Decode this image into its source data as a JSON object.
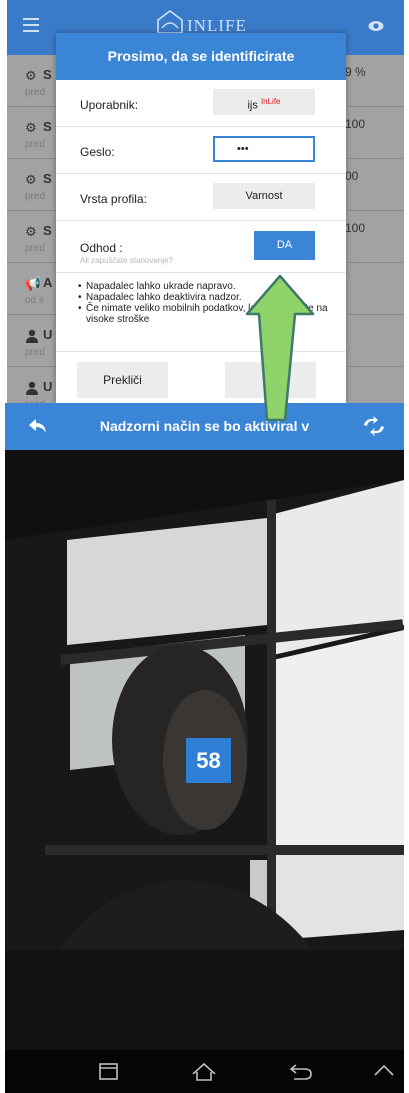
{
  "top": {
    "app_title": "INLIFE",
    "list": [
      {
        "icon": "gear-icon",
        "title": "S",
        "sub": "pred",
        "value": "9 %"
      },
      {
        "icon": "gear-icon",
        "title": "S",
        "sub": "pred",
        "value": "100"
      },
      {
        "icon": "gear-icon",
        "title": "S",
        "sub": "pred",
        "value": "00"
      },
      {
        "icon": "gear-icon",
        "title": "S",
        "sub": "pred",
        "value": "100"
      },
      {
        "icon": "megaphone-icon",
        "title": "A",
        "sub": "od s",
        "value": ""
      },
      {
        "icon": "user-icon",
        "title": "U",
        "sub": "pred",
        "value": ""
      },
      {
        "icon": "user-icon",
        "title": "U",
        "sub": "pred",
        "value": ""
      }
    ],
    "dialog": {
      "title": "Prosimo, da se identificirate",
      "user_label": "Uporabnik:",
      "user_value": "ijs",
      "user_value_sup": "InLife",
      "password_label": "Geslo:",
      "password_value": "•••",
      "profile_label": "Vrsta profila:",
      "profile_value": "Varnost",
      "leave_label": "Odhod :",
      "leave_sub": "Ali zapuščate stanovanje?",
      "leave_button": "DA",
      "notes": [
        "Napadalec lahko ukrade napravo.",
        "Napadalec lahko deaktivira nadzor.",
        "Če nimate veliko mobilnih podatkov, lahko računate na visoke stroške"
      ],
      "cancel_button": "Prekliči"
    }
  },
  "bottom": {
    "title": "Nadzorni način se bo aktiviral v",
    "countdown": "58"
  },
  "colors": {
    "primary_blue": "#3a85d6",
    "header_blue": "#3a7bc9",
    "arrow_green": "#8fd36a"
  }
}
